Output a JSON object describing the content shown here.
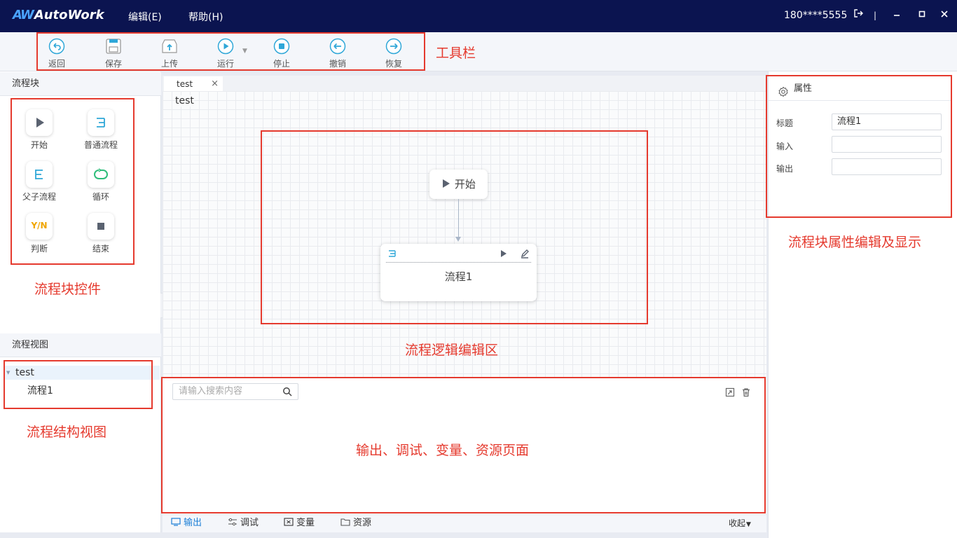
{
  "app": {
    "logo_mark": "AW",
    "logo_text": "AutoWork",
    "menu": [
      "编辑(E)",
      "帮助(H)"
    ],
    "user": "180****5555"
  },
  "toolbar": {
    "items": [
      "返回",
      "保存",
      "上传",
      "运行",
      "停止",
      "撤销",
      "恢复"
    ]
  },
  "left": {
    "blocks_title": "流程块",
    "blocks": [
      "开始",
      "普通流程",
      "父子流程",
      "循环",
      "判断",
      "结束"
    ],
    "view_title": "流程视图",
    "tree": {
      "root": "test",
      "child": "流程1"
    }
  },
  "editor": {
    "tab": "test",
    "canvas_title": "test",
    "start_node": "开始",
    "flow_node": "流程1",
    "yn_text": "Y/N"
  },
  "output": {
    "search_placeholder": "请输入搜索内容",
    "tabs": [
      "输出",
      "调试",
      "变量",
      "资源"
    ],
    "collapse": "收起"
  },
  "properties": {
    "title": "属性",
    "fields": [
      {
        "label": "标题",
        "value": "流程1"
      },
      {
        "label": "输入",
        "value": ""
      },
      {
        "label": "输出",
        "value": ""
      }
    ]
  },
  "annotations": {
    "toolbar": "工具栏",
    "blocks": "流程块控件",
    "editor": "流程逻辑编辑区",
    "structure": "流程结构视图",
    "properties": "流程块属性编辑及显示",
    "output": "输出、调试、变量、资源页面"
  },
  "colors": {
    "titlebar": "#0b1450",
    "accent": "#2fa7d8",
    "annotation": "#e53a2e"
  }
}
